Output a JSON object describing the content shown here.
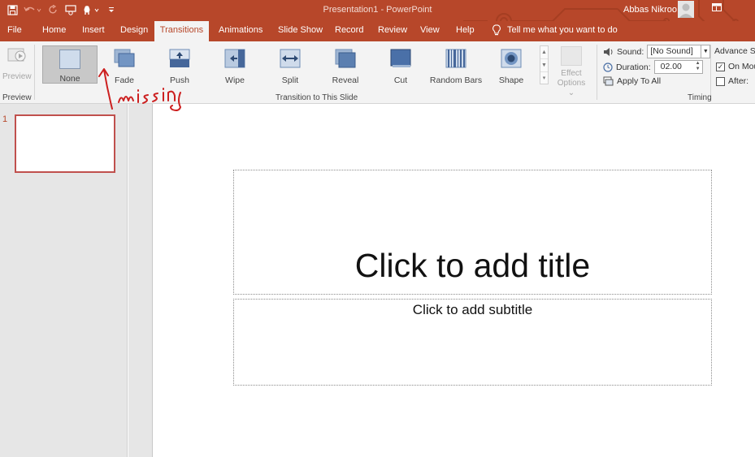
{
  "titlebar": {
    "document_title": "Presentation1  -  PowerPoint",
    "user_name": "Abbas Nikroo",
    "qat_icons": [
      "save-icon",
      "undo-icon",
      "redo-icon",
      "present-icon",
      "touch-mode-icon",
      "customize-icon"
    ]
  },
  "tabs": [
    {
      "label": "File"
    },
    {
      "label": "Home"
    },
    {
      "label": "Insert"
    },
    {
      "label": "Design"
    },
    {
      "label": "Transitions",
      "active": true
    },
    {
      "label": "Animations"
    },
    {
      "label": "Slide Show"
    },
    {
      "label": "Record"
    },
    {
      "label": "Review"
    },
    {
      "label": "View"
    },
    {
      "label": "Help"
    }
  ],
  "tell_me": "Tell me what you want to do",
  "ribbon": {
    "preview": {
      "button_label": "Preview",
      "group_label": "Preview"
    },
    "transitions": [
      {
        "label": "None",
        "selected": true
      },
      {
        "label": "Fade"
      },
      {
        "label": "Push"
      },
      {
        "label": "Wipe"
      },
      {
        "label": "Split"
      },
      {
        "label": "Reveal"
      },
      {
        "label": "Cut"
      },
      {
        "label": "Random Bars"
      },
      {
        "label": "Shape"
      }
    ],
    "effect_options": {
      "line1": "Effect",
      "line2": "Options ⌄"
    },
    "group_label_transition": "Transition to This Slide",
    "timing": {
      "sound_label": "Sound:",
      "sound_value": "[No Sound]",
      "duration_label": "Duration:",
      "duration_value": "02.00",
      "apply_label": "Apply To All",
      "advance_label": "Advance Sli",
      "on_mouse_label": "On Mou",
      "on_mouse_checked": true,
      "after_label": "After:",
      "after_checked": false,
      "group_label": "Timing"
    }
  },
  "slides_pane": {
    "slide_number": "1"
  },
  "slide": {
    "title_placeholder": "Click to add title",
    "subtitle_placeholder": "Click to add subtitle"
  },
  "annotation": {
    "text": "missing",
    "color": "#cc1f1f"
  },
  "colors": {
    "accent": "#b7472a",
    "selected_thumb_border": "#c0504d"
  }
}
